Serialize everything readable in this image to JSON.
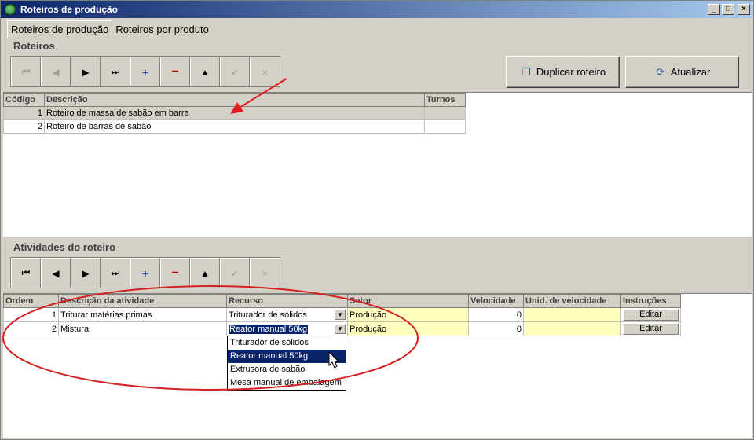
{
  "window": {
    "title": "Roteiros de produção"
  },
  "tabs": [
    {
      "label": "Roteiros de produção"
    },
    {
      "label": "Roteiros por produto"
    }
  ],
  "roteiros": {
    "section_label": "Roteiros",
    "duplicate_button": "Duplicar roteiro",
    "refresh_button": "Atualizar",
    "columns": [
      "Código",
      "Descrição",
      "Turnos"
    ],
    "rows": [
      {
        "codigo": "1",
        "descricao": "Roteiro de massa de sabão em barra",
        "turnos": ""
      },
      {
        "codigo": "2",
        "descricao": "Roteiro de barras de sabão",
        "turnos": ""
      }
    ]
  },
  "atividades": {
    "section_label": "Atividades do roteiro",
    "columns": [
      "Ordem",
      "Descrição da atividade",
      "Recurso",
      "Setor",
      "Velocidade",
      "Unid. de velocidade",
      "Instruções"
    ],
    "rows": [
      {
        "ordem": "1",
        "descricao": "Triturar matérias primas",
        "recurso": "Triturador de sólidos",
        "setor": "Produção",
        "velocidade": "0",
        "unidade": "",
        "instrucoes": "Editar"
      },
      {
        "ordem": "2",
        "descricao": "Mistura",
        "recurso": "Reator manual 50kg",
        "setor": "Produção",
        "velocidade": "0",
        "unidade": "",
        "instrucoes": "Editar"
      }
    ],
    "dropdown_options": [
      "Triturador de sólidos",
      "Reator manual 50kg",
      "Extrusora de sabão",
      "Mesa manual de embalagem"
    ],
    "dropdown_selected": "Reator manual 50kg"
  },
  "colors": {
    "titlebar": "#0a246a",
    "annotation": "#e02020",
    "highlight": "#0a246a",
    "edit_cell": "#ffffc0"
  }
}
